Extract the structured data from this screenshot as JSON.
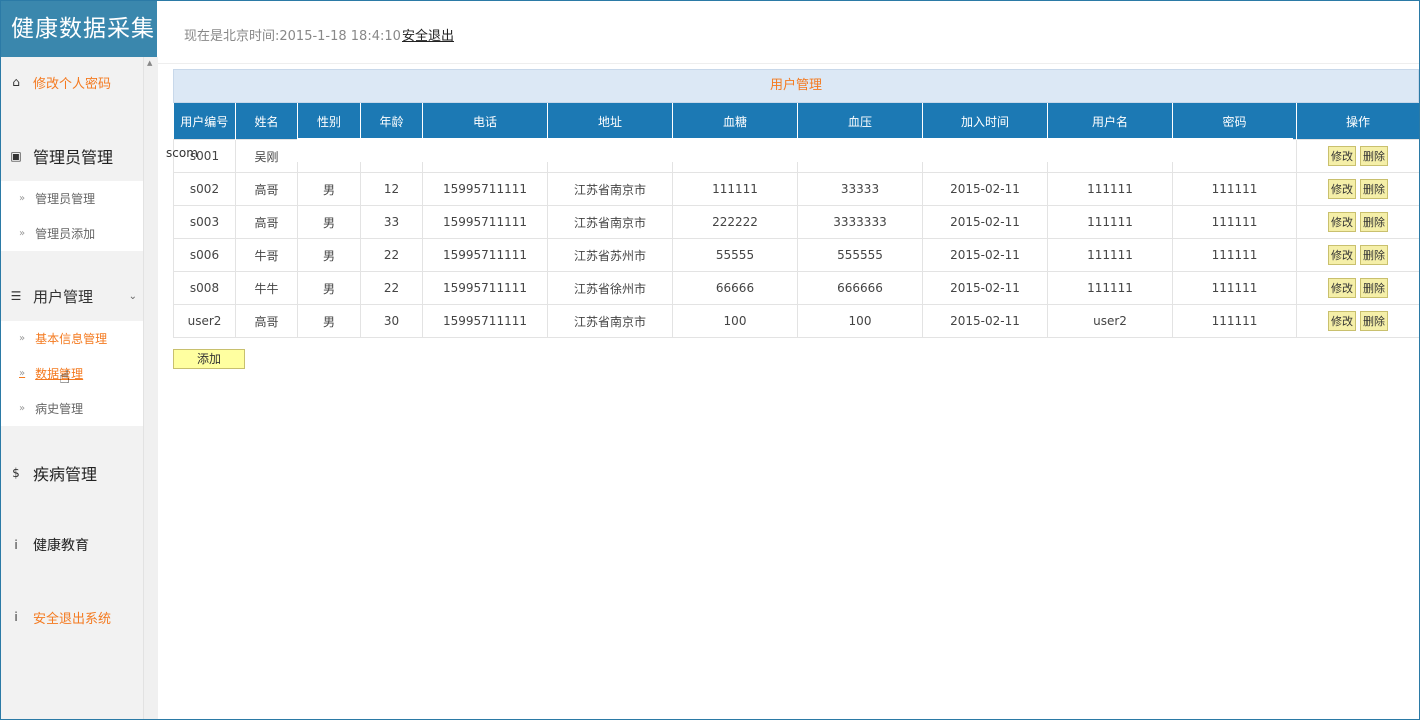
{
  "app": {
    "title": "健康数据采集"
  },
  "header": {
    "time_text": "现在是北京时间:2015-1-18 18:4:10",
    "logout_label": "安全退出"
  },
  "sidebar": {
    "change_password": "修改个人密码",
    "admin_section": {
      "label": "管理员管理",
      "items": [
        "管理员管理",
        "管理员添加"
      ]
    },
    "user_section": {
      "label": "用户管理",
      "items": [
        "基本信息管理",
        "数据管理",
        "病史管理"
      ]
    },
    "disease": "疾病管理",
    "education": "健康教育",
    "exit_system": "安全退出系统"
  },
  "table": {
    "title": "用户管理",
    "headers": [
      "用户编号",
      "姓名",
      "性别",
      "年龄",
      "电话",
      "地址",
      "血糖",
      "血压",
      "加入时间",
      "用户名",
      "密码",
      "操作"
    ],
    "rows": [
      [
        "s001",
        "吴刚",
        "",
        "",
        "",
        "",
        "",
        "",
        "",
        "",
        "",
        ""
      ],
      [
        "s002",
        "高哥",
        "男",
        "12",
        "15995711111",
        "江苏省南京市",
        "111111",
        "33333",
        "2015-02-11",
        "111111",
        "111111",
        ""
      ],
      [
        "s003",
        "高哥",
        "男",
        "33",
        "15995711111",
        "江苏省南京市",
        "222222",
        "3333333",
        "2015-02-11",
        "111111",
        "111111",
        ""
      ],
      [
        "s006",
        "牛哥",
        "男",
        "22",
        "15995711111",
        "江苏省苏州市",
        "55555",
        "555555",
        "2015-02-11",
        "111111",
        "111111",
        ""
      ],
      [
        "s008",
        "牛牛",
        "男",
        "22",
        "15995711111",
        "江苏省徐州市",
        "66666",
        "666666",
        "2015-02-11",
        "111111",
        "111111",
        ""
      ],
      [
        "user2",
        "高哥",
        "男",
        "30",
        "15995711111",
        "江苏省南京市",
        "100",
        "100",
        "2015-02-11",
        "user2",
        "111111",
        ""
      ]
    ],
    "edit_label": "修改",
    "delete_label": "删除",
    "add_label": "添加"
  },
  "overlay": {
    "scom": "scom"
  },
  "colors": {
    "brand": "#3a87ad",
    "header": "#1c79b4",
    "accent": "#f47a20"
  }
}
